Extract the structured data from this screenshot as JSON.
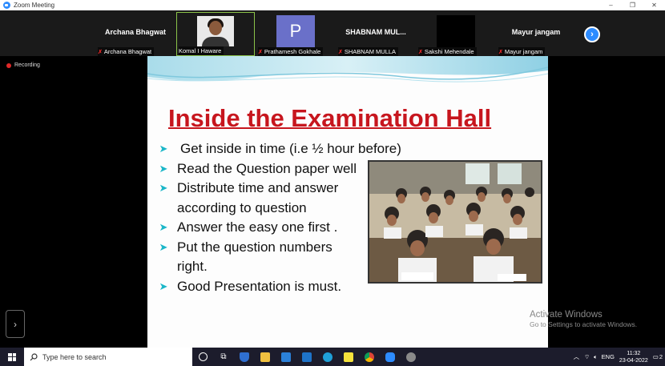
{
  "window": {
    "title": "Zoom Meeting",
    "controls": [
      "–",
      "❐",
      "✕"
    ]
  },
  "participants": [
    {
      "big_name": "Archana Bhagwat",
      "label": "Archana Bhagwat"
    },
    {
      "big_name": "",
      "label": "Komal I Haware"
    },
    {
      "avatar_letter": "P",
      "label": "Prathamesh Gokhale"
    },
    {
      "big_name": "SHABNAM  MUL...",
      "label": "SHABNAM MULLA"
    },
    {
      "big_name": "",
      "label": "Sakshi Mehendale"
    },
    {
      "big_name": "Mayur jangam",
      "label": "Mayur jangam"
    }
  ],
  "status": {
    "recording": "Recording"
  },
  "slide": {
    "title": "Inside the Examination Hall",
    "bullets": [
      {
        "text": "Get inside in time (i.e ½ hour before)"
      },
      {
        "text": "Read the Question paper  well"
      },
      {
        "text": "Distribute time and answer",
        "cont": "according to question"
      },
      {
        "text": "Answer the easy one first ."
      },
      {
        "text": "Put the question numbers",
        "cont": "right."
      },
      {
        "text": "Good Presentation is must."
      }
    ]
  },
  "watermark": {
    "line1": "Activate Windows",
    "line2": "Go to Settings to activate Windows."
  },
  "taskbar": {
    "search_placeholder": "Type here to search",
    "lang": "ENG",
    "time": "11:32",
    "date": "23-04-2022",
    "notification_count": "2"
  },
  "colors": {
    "title_red": "#c7161e",
    "bullet_teal": "#1ab6c8",
    "zoom_blue": "#2d8cff",
    "active_speaker_green": "#8bc34a"
  }
}
